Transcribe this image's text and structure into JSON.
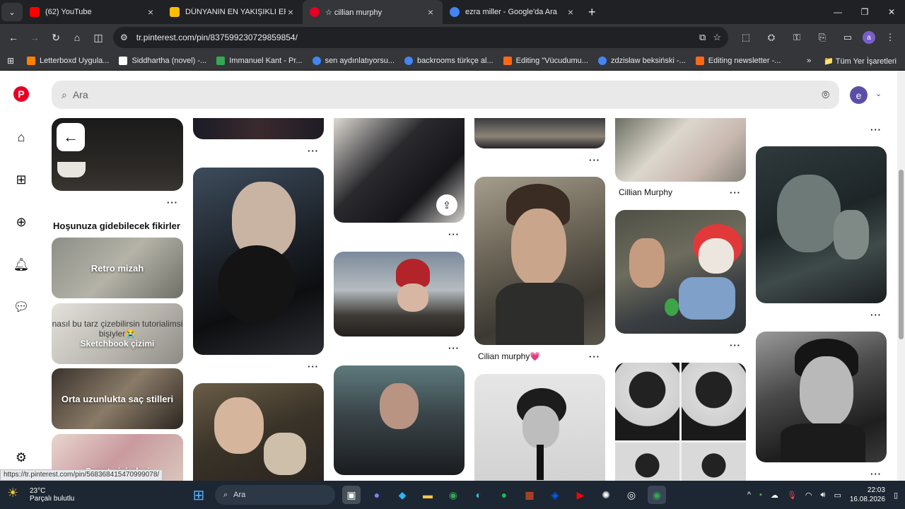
{
  "browser": {
    "tabs": [
      {
        "title": "(62) YouTube",
        "icon": "youtube-icon",
        "color": "#ff0000"
      },
      {
        "title": "DÜNYANIN EN YAKIŞIKLI ERKE",
        "icon": "drive-icon",
        "color": "#fbbc04"
      },
      {
        "title": "☆ cillian murphy",
        "icon": "pinterest-icon",
        "color": "#e60023"
      },
      {
        "title": "ezra miller - Google'da Ara",
        "icon": "google-icon",
        "color": "#4285f4"
      }
    ],
    "url": "tr.pinterest.com/pin/837599230729859854/",
    "bookmarks": [
      {
        "label": "Letterboxd Uygula...",
        "color": "#ff8000"
      },
      {
        "label": "Siddhartha (novel) -...",
        "color": "#ffffff"
      },
      {
        "label": "Immanuel Kant - Pr...",
        "color": "#34a853"
      },
      {
        "label": "sen aydınlatıyorsu...",
        "color": "#4285f4"
      },
      {
        "label": "backrooms türkçe al...",
        "color": "#4285f4"
      },
      {
        "label": "Editing \"Vücudumu...",
        "color": "#ff6719"
      },
      {
        "label": "zdzisław beksiński -...",
        "color": "#4285f4"
      },
      {
        "label": "Editing newsletter -...",
        "color": "#ff6719"
      }
    ],
    "all_bookmarks": "Tüm Yer İşaretleri",
    "profile_letter": "a"
  },
  "pinterest": {
    "search_placeholder": "Ara",
    "avatar_letter": "e",
    "ideas_heading": "Hoşunuza gidebilecek fikirler",
    "ideas": [
      {
        "label": "Retro mizah"
      },
      {
        "label": "nasıl bu tarz çizebilirsin tutorialimsi bişiyler😭"
      },
      {
        "label": "Sketchbook çizimi"
      },
      {
        "label": "Orta uzunlukta saç stilleri"
      },
      {
        "label": "Sanat çizimleri"
      }
    ],
    "captions": {
      "c1": "Cillian Murphy",
      "c2": "Cilian murphy💗"
    },
    "more": "···"
  },
  "status_url": "https://tr.pinterest.com/pin/568368415470999078/",
  "taskbar": {
    "temp": "23°C",
    "weather": "Parçalı bulutlu",
    "search": "Ara",
    "time": "22:03",
    "date": "16.08.2026"
  }
}
